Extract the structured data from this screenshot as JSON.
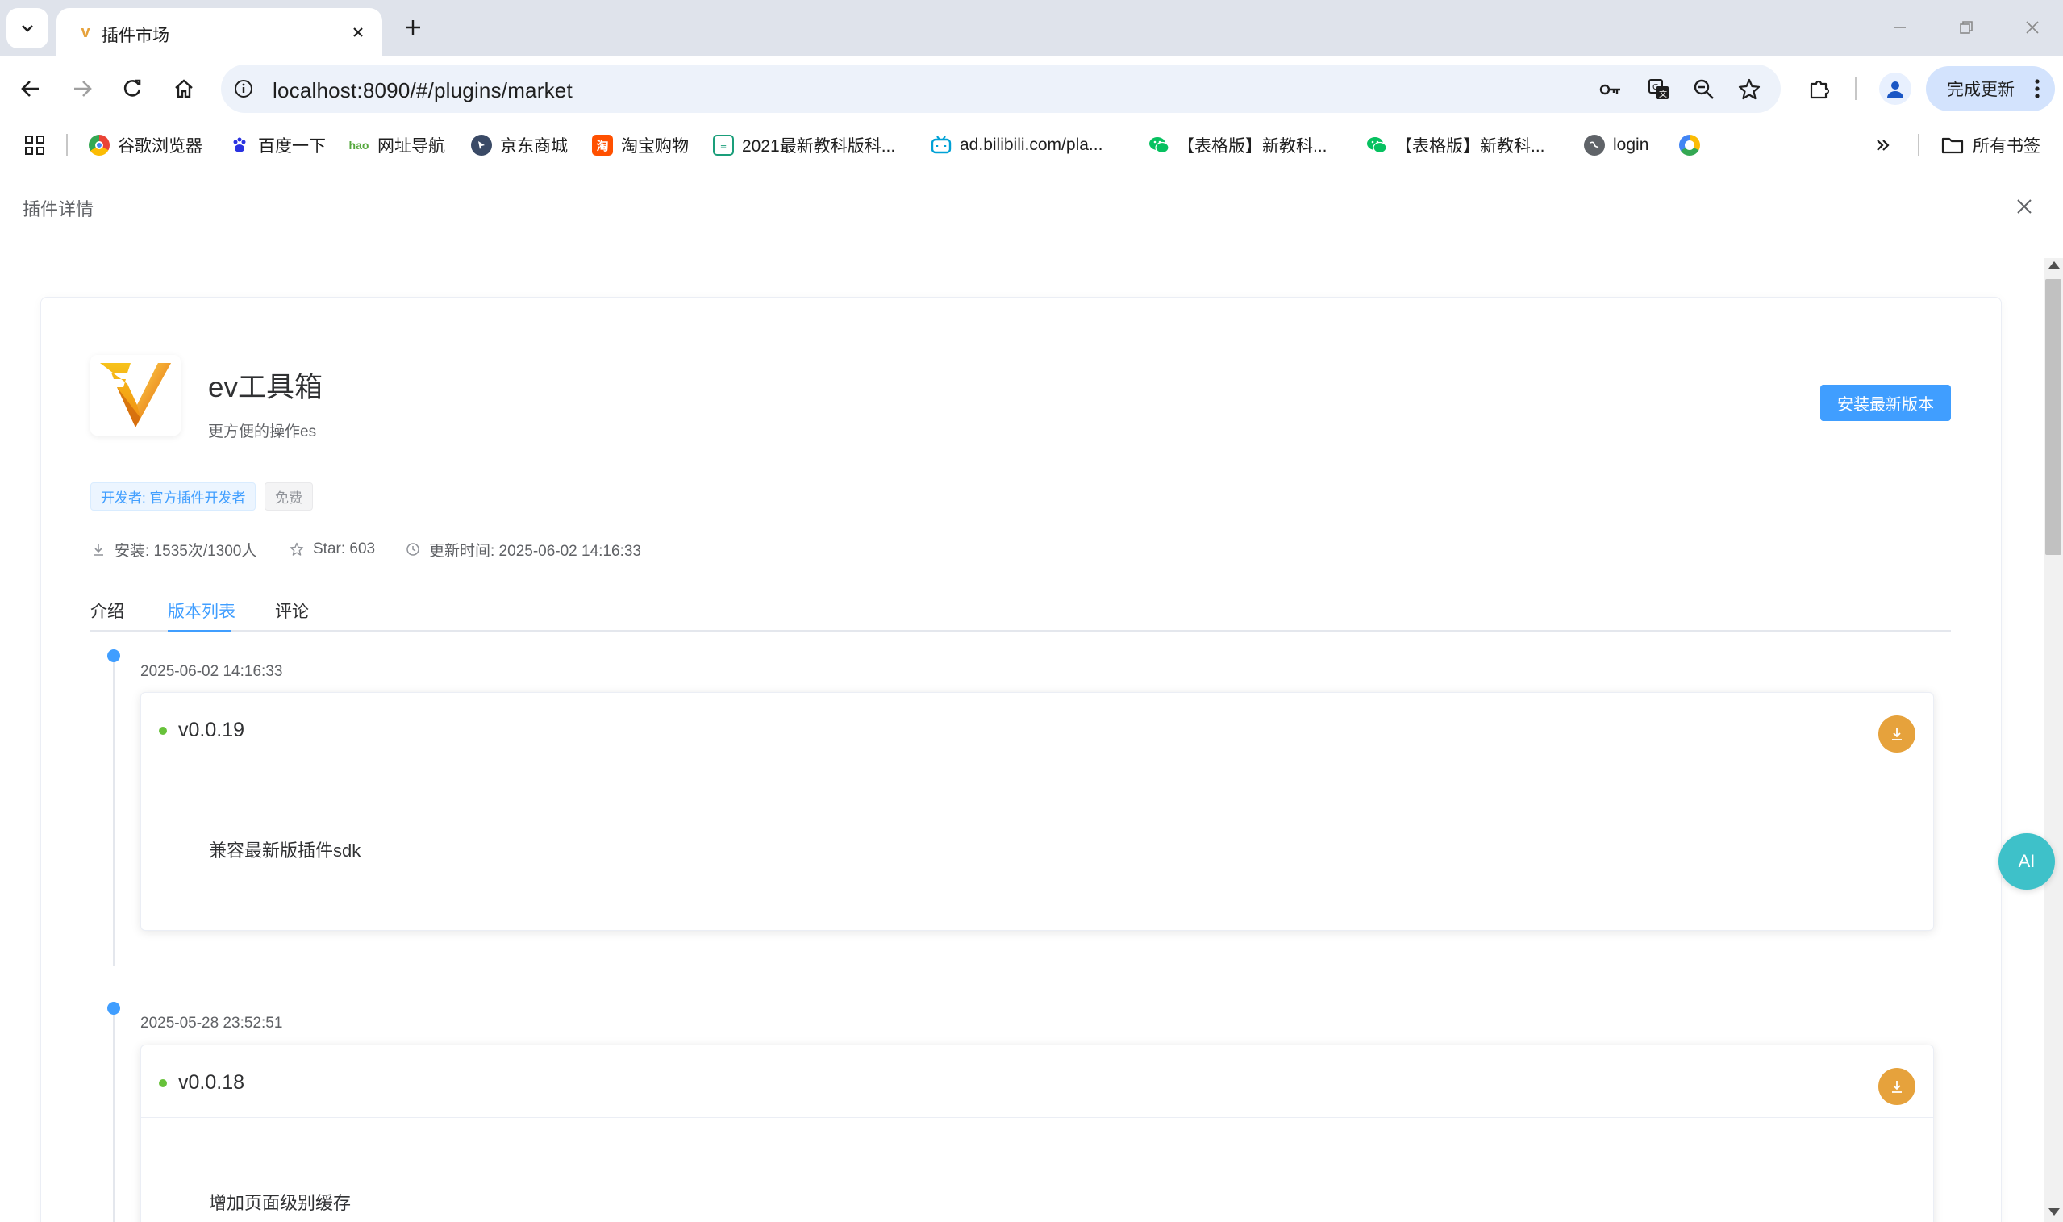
{
  "browser": {
    "tab_title": "插件市场",
    "tab_favicon_text": "v",
    "url": "localhost:8090/#/plugins/market",
    "update_label": "完成更新",
    "bookmarks": [
      {
        "label": "谷歌浏览器",
        "icon": "chrome-icon",
        "color": "#ea4335"
      },
      {
        "label": "百度一下",
        "icon": "baidu-paw-icon",
        "color": "#2932e1"
      },
      {
        "label": "网址导航",
        "icon": "hao123-icon",
        "color": "#56a83e"
      },
      {
        "label": "京东商城",
        "icon": "cursor-icon",
        "color": "#3a4a66"
      },
      {
        "label": "淘宝购物",
        "icon": "taobao-icon",
        "color": "#ff5000"
      },
      {
        "label": "2021最新教科版科...",
        "icon": "document-icon",
        "color": "#1a9e7a"
      },
      {
        "label": "ad.bilibili.com/pla...",
        "icon": "bilibili-icon",
        "color": "#00a1d6"
      },
      {
        "label": "【表格版】新教科...",
        "icon": "wechat-icon",
        "color": "#07c160"
      },
      {
        "label": "【表格版】新教科...",
        "icon": "wechat-icon",
        "color": "#07c160"
      },
      {
        "label": "login",
        "icon": "globe-icon",
        "color": "#5f6368"
      },
      {
        "label": "",
        "icon": "colorful-circle-icon",
        "color": "#fbbc04"
      }
    ],
    "all_bookmarks_label": "所有书签"
  },
  "drawer": {
    "title": "插件详情"
  },
  "plugin": {
    "name": "ev工具箱",
    "description": "更方便的操作es",
    "install_label": "安装最新版本",
    "tags": {
      "developer": "开发者: 官方插件开发者",
      "price": "免费"
    },
    "stats": {
      "installs": "安装: 1535次/1300人",
      "stars": "Star: 603",
      "updated": "更新时间: 2025-06-02 14:16:33"
    },
    "tabs": [
      "介绍",
      "版本列表",
      "评论"
    ],
    "active_tab": "版本列表"
  },
  "versions": [
    {
      "time": "2025-06-02 14:16:33",
      "version": "v0.0.19",
      "note": "兼容最新版插件sdk"
    },
    {
      "time": "2025-05-28 23:52:51",
      "version": "v0.0.18",
      "note": "增加页面级别缓存"
    }
  ],
  "ai_button_label": "AI",
  "colors": {
    "primary": "#409eff",
    "warning": "#e6a23c",
    "success": "#67c23a",
    "ai": "#3ec1c9"
  }
}
